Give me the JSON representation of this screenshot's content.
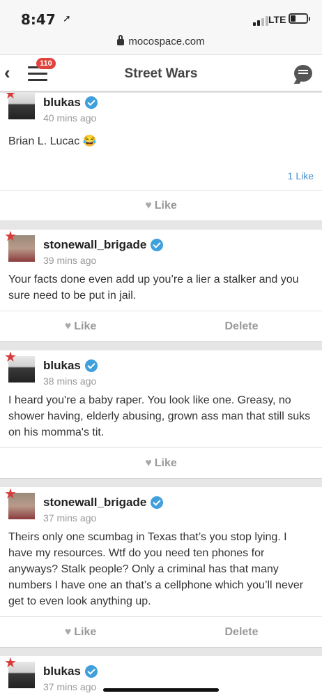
{
  "status": {
    "time": "8:47",
    "network": "LTE"
  },
  "browser": {
    "url": "mocospace.com"
  },
  "nav": {
    "badge": "110",
    "title": "Street Wars"
  },
  "actions": {
    "like": "Like",
    "delete": "Delete"
  },
  "posts": [
    {
      "user": "blukas",
      "time": "40 mins ago",
      "text": "Brian L. Lucac 😂",
      "likes": "1 Like"
    },
    {
      "user": "stonewall_brigade",
      "time": "39 mins ago",
      "text": "Your facts done even add up you’re a lier a stalker and you sure need to be put in jail."
    },
    {
      "user": "blukas",
      "time": "38 mins ago",
      "text": "I heard you're a baby raper. You look like one. Greasy, no shower having, elderly abusing, grown ass man that still suks on his momma's tit."
    },
    {
      "user": "stonewall_brigade",
      "time": "37 mins ago",
      "text": "Theirs only one scumbag in Texas that’s you stop lying. I have my resources. Wtf do you need ten phones for anyways? Stalk people? Only a criminal has that many numbers I have one an that’s a cellphone which you’ll never get to even look anything up."
    },
    {
      "user": "blukas",
      "time": "37 mins ago"
    }
  ]
}
